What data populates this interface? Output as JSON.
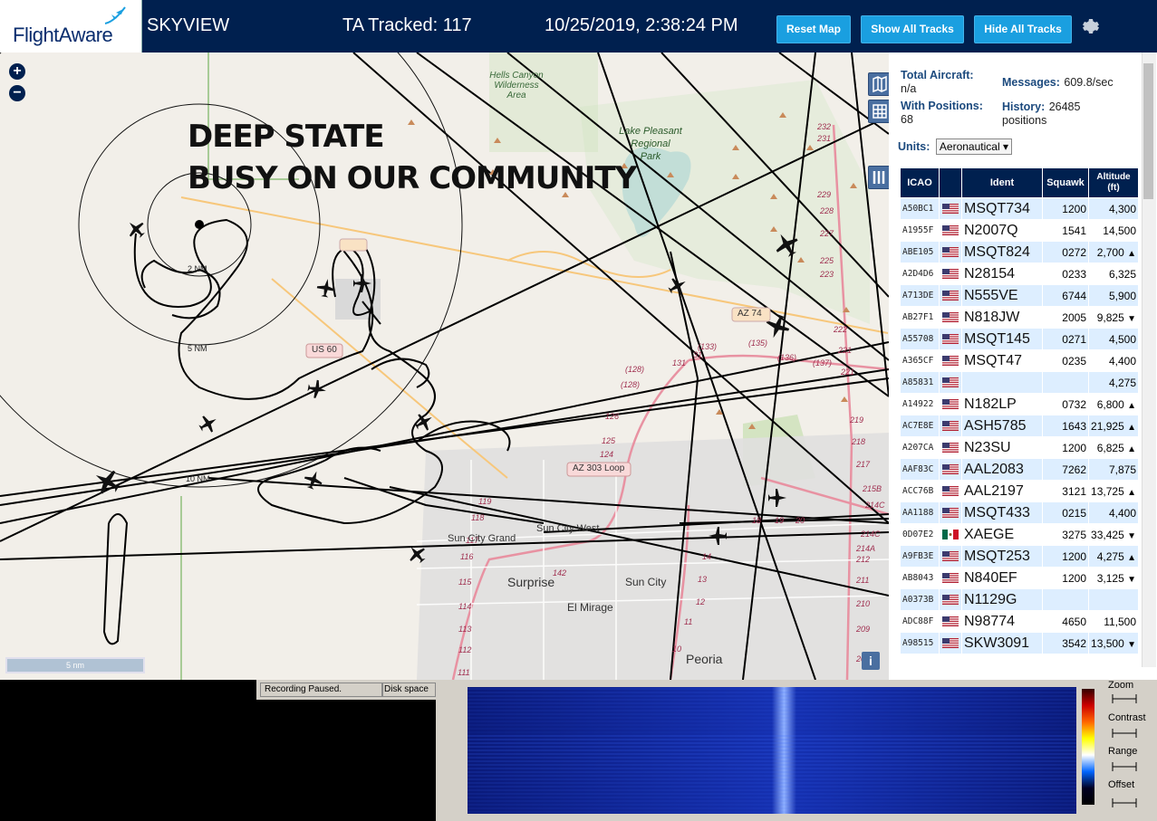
{
  "header": {
    "logo": "FlightAware",
    "app_name": "SKYVIEW",
    "tracked": "TA Tracked: 117",
    "datetime": "10/25/2019, 2:38:24 PM",
    "buttons": {
      "reset": "Reset Map",
      "show": "Show All Tracks",
      "hide": "Hide All Tracks"
    }
  },
  "map": {
    "overlay_line1": "DEEP STATE",
    "overlay_line2": "BUSY ON OUR COMMUNITY",
    "scale_label": "5 nm",
    "labels": {
      "hells_canyon": "Hells Canyon",
      "wilderness": "Wilderness",
      "area": "Area",
      "lake_pleasant": "Lake Pleasant",
      "regional": "Regional",
      "park": "Park",
      "az74": "AZ 74",
      "us60": "US 60",
      "loop303": "AZ 303 Loop",
      "sun_city_west": "Sun City West",
      "sun_city_grand": "Sun City Grand",
      "surprise": "Surprise",
      "sun_city": "Sun City",
      "el_mirage": "El Mirage",
      "peoria": "Peoria",
      "ring_2nm": "2 NM",
      "ring_5nm": "5 NM",
      "ring_10nm": "10 NM"
    }
  },
  "sidebar": {
    "total_aircraft_label": "Total Aircraft:",
    "total_aircraft_value": "n/a",
    "messages_label": "Messages:",
    "messages_value": "609.8/sec",
    "with_positions_label": "With Positions:",
    "with_positions_value": "68",
    "history_label": "History:",
    "history_value": "26485",
    "history_unit": "positions",
    "units_label": "Units:",
    "units_value": "Aeronautical",
    "columns": [
      "ICAO",
      "",
      "Ident",
      "Squawk",
      "Altitude (ft)"
    ],
    "rows": [
      {
        "icao": "A50BC1",
        "flag": "us",
        "ident": "MSQT734",
        "squawk": "1200",
        "alt": "4,300",
        "trend": ""
      },
      {
        "icao": "A1955F",
        "flag": "us",
        "ident": "N2007Q",
        "squawk": "1541",
        "alt": "14,500",
        "trend": ""
      },
      {
        "icao": "ABE105",
        "flag": "us",
        "ident": "MSQT824",
        "squawk": "0272",
        "alt": "2,700",
        "trend": "▲"
      },
      {
        "icao": "A2D4D6",
        "flag": "us",
        "ident": "N28154",
        "squawk": "0233",
        "alt": "6,325",
        "trend": ""
      },
      {
        "icao": "A713DE",
        "flag": "us",
        "ident": "N555VE",
        "squawk": "6744",
        "alt": "5,900",
        "trend": ""
      },
      {
        "icao": "AB27F1",
        "flag": "us",
        "ident": "N818JW",
        "squawk": "2005",
        "alt": "9,825",
        "trend": "▼"
      },
      {
        "icao": "A55708",
        "flag": "us",
        "ident": "MSQT145",
        "squawk": "0271",
        "alt": "4,500",
        "trend": ""
      },
      {
        "icao": "A365CF",
        "flag": "us",
        "ident": "MSQT47",
        "squawk": "0235",
        "alt": "4,400",
        "trend": ""
      },
      {
        "icao": "A85831",
        "flag": "us",
        "ident": "",
        "squawk": "",
        "alt": "4,275",
        "trend": ""
      },
      {
        "icao": "A14922",
        "flag": "us",
        "ident": "N182LP",
        "squawk": "0732",
        "alt": "6,800",
        "trend": "▲"
      },
      {
        "icao": "AC7E8E",
        "flag": "us",
        "ident": "ASH5785",
        "squawk": "1643",
        "alt": "21,925",
        "trend": "▲"
      },
      {
        "icao": "A207CA",
        "flag": "us",
        "ident": "N23SU",
        "squawk": "1200",
        "alt": "6,825",
        "trend": "▲"
      },
      {
        "icao": "AAF83C",
        "flag": "us",
        "ident": "AAL2083",
        "squawk": "7262",
        "alt": "7,875",
        "trend": ""
      },
      {
        "icao": "ACC76B",
        "flag": "us",
        "ident": "AAL2197",
        "squawk": "3121",
        "alt": "13,725",
        "trend": "▲"
      },
      {
        "icao": "AA1188",
        "flag": "us",
        "ident": "MSQT433",
        "squawk": "0215",
        "alt": "4,400",
        "trend": ""
      },
      {
        "icao": "0D07E2",
        "flag": "mx",
        "ident": "XAEGE",
        "squawk": "3275",
        "alt": "33,425",
        "trend": "▼"
      },
      {
        "icao": "A9FB3E",
        "flag": "us",
        "ident": "MSQT253",
        "squawk": "1200",
        "alt": "4,275",
        "trend": "▲"
      },
      {
        "icao": "AB8043",
        "flag": "us",
        "ident": "N840EF",
        "squawk": "1200",
        "alt": "3,125",
        "trend": "▼"
      },
      {
        "icao": "A0373B",
        "flag": "us",
        "ident": "N1129G",
        "squawk": "",
        "alt": "",
        "trend": ""
      },
      {
        "icao": "ADC88F",
        "flag": "us",
        "ident": "N98774",
        "squawk": "4650",
        "alt": "11,500",
        "trend": ""
      },
      {
        "icao": "A98515",
        "flag": "us",
        "ident": "SKW3091",
        "squawk": "3542",
        "alt": "13,500",
        "trend": "▼"
      }
    ]
  },
  "bottom": {
    "recording": "Recording Paused.",
    "disk": "Disk space",
    "sdr_labels": {
      "zoom": "Zoom",
      "contrast": "Contrast",
      "range": "Range",
      "offset": "Offset"
    }
  },
  "colors": {
    "header_bg": "#00204f",
    "button": "#1a9fe0",
    "map_bg": "#f2efe9",
    "table_header": "#00204f",
    "row_alt": "#ddeeff"
  }
}
